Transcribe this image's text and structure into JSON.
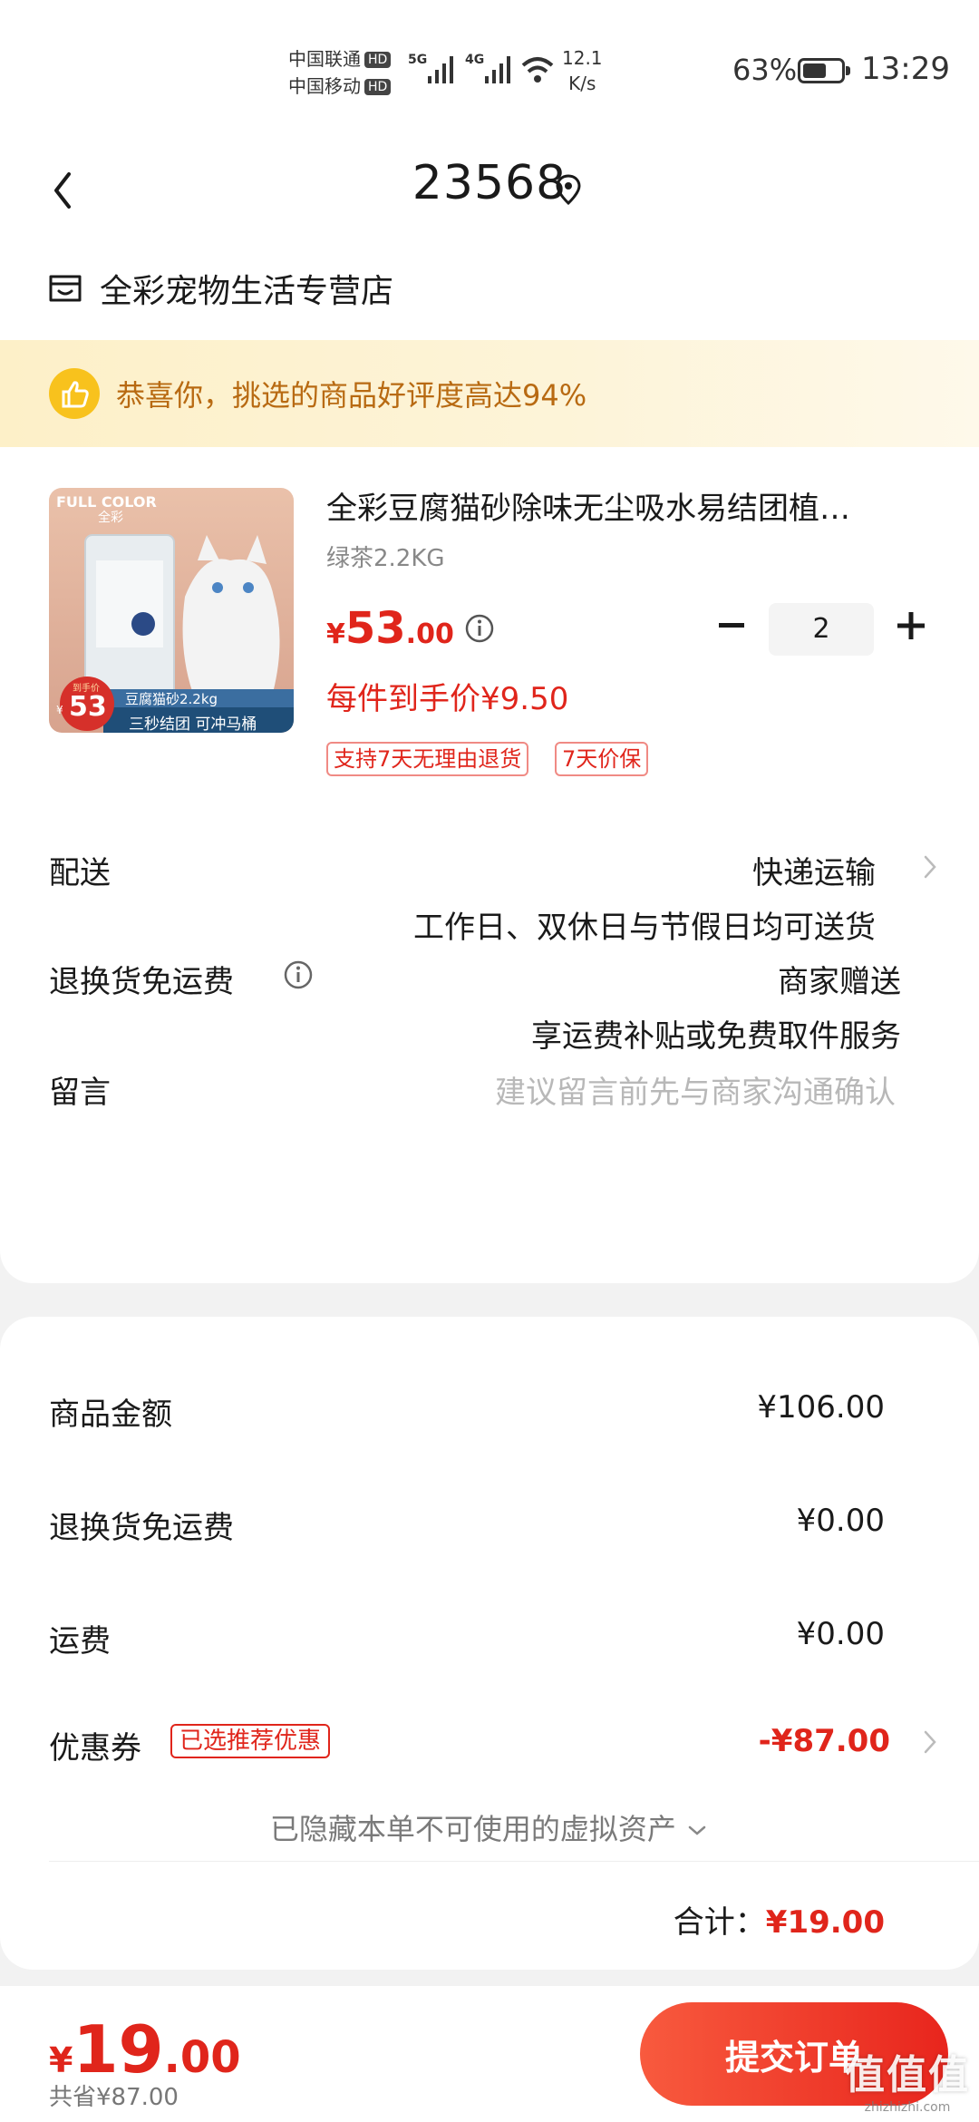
{
  "status_bar": {
    "carrier1": "中国联通",
    "carrier2": "中国移动",
    "hd": "HD",
    "net1": "5G",
    "net2": "4G",
    "speed_value": "12.1",
    "speed_unit": "K/s",
    "battery": "63%",
    "battery_level": 0.63,
    "time": "13:29"
  },
  "header": {
    "title": "23568",
    "shop_name": "全彩宠物生活专营店"
  },
  "banner": {
    "text": "恭喜你，挑选的商品好评度高达94%"
  },
  "product": {
    "title": "全彩豆腐猫砂除味无尘吸水易结团植…",
    "spec": "绿茶2.2KG",
    "price_currency": "¥",
    "price_int": "53",
    "price_dec": ".00",
    "quantity": "2",
    "unit_price_text": "每件到手价¥9.50",
    "tags": [
      "支持7天无理由退货",
      "7天价保"
    ],
    "image": {
      "brand": "FULL COLOR",
      "brand_cn": "全彩",
      "badge_top": "到手价",
      "badge_price": "53",
      "badge_currency": "¥",
      "line1": "豆腐猫砂2.2kg",
      "line2": "三秒结团  可冲马桶"
    }
  },
  "delivery": {
    "label": "配送",
    "method": "快递运输",
    "desc": "工作日、双休日与节假日均可送货"
  },
  "return_insurance": {
    "label": "退换货免运费",
    "value": "商家赠送",
    "desc": "享运费补贴或免费取件服务"
  },
  "message": {
    "label": "留言",
    "placeholder": "建议留言前先与商家沟通确认"
  },
  "summary": {
    "items": [
      {
        "label": "商品金额",
        "value": "¥106.00"
      },
      {
        "label": "退换货免运费",
        "value": "¥0.00"
      },
      {
        "label": "运费",
        "value": "¥0.00"
      }
    ],
    "coupon_label": "优惠券",
    "coupon_tag": "已选推荐优惠",
    "coupon_value": "-¥87.00",
    "hidden_assets": "已隐藏本单不可使用的虚拟资产",
    "total_label": "合计：",
    "total_value": "¥19.00"
  },
  "bottom_bar": {
    "currency": "¥",
    "price_int": "19",
    "price_dec": ".00",
    "saved": "共省¥87.00",
    "submit": "提交订单"
  },
  "watermark": {
    "big": "值值值",
    "small": "zhizhizhi.com"
  },
  "colors": {
    "accent": "#e0251b",
    "banner_text": "#b86a12",
    "banner_bg": "#fdf0c8"
  }
}
